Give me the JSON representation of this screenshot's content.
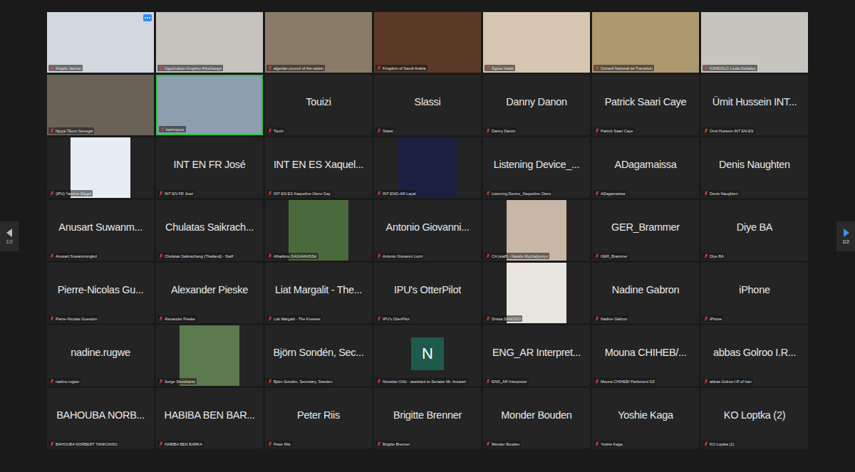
{
  "meeting": {
    "view": "gallery"
  },
  "pager": {
    "previous": {
      "label": "1/2",
      "enabled": false
    },
    "next": {
      "label": "1/2",
      "enabled": true
    }
  },
  "tiles": [
    {
      "kind": "video",
      "label": "Angelo Jacinto",
      "muted": true,
      "speaking": false,
      "color": "#d3d8e0",
      "menu": true
    },
    {
      "kind": "video",
      "label": "Ugochukwu Kingsley Ahuchaogu",
      "muted": true,
      "speaking": false,
      "color": "#c6c3bf",
      "menu": false
    },
    {
      "kind": "video",
      "label": "algerian council of the nation",
      "muted": true,
      "speaking": false,
      "color": "#8a7b68",
      "menu": false
    },
    {
      "kind": "video",
      "label": "Kingdom of Saudi Arabia",
      "muted": true,
      "speaking": false,
      "color": "#5a3a27",
      "menu": false
    },
    {
      "kind": "video",
      "label": "Ágnes Vadai",
      "muted": true,
      "speaking": false,
      "color": "#d6c6b2",
      "menu": false
    },
    {
      "kind": "video",
      "label": "Conseil National de Transition",
      "muted": true,
      "speaking": false,
      "color": "#ad9870",
      "menu": false
    },
    {
      "kind": "video",
      "label": "KANDOLO Linda Gwladys",
      "muted": true,
      "speaking": false,
      "color": "#c7c5bf",
      "menu": false
    },
    {
      "kind": "video",
      "label": "Njoya Tikum-Senegal",
      "muted": true,
      "speaking": false,
      "color": "#6a6157",
      "menu": false
    },
    {
      "kind": "video",
      "label": "karimipour",
      "muted": true,
      "speaking": true,
      "color": "#8d9fae",
      "menu": false
    },
    {
      "kind": "name",
      "display": "Touizi",
      "label": "Touizi",
      "muted": true,
      "speaking": false,
      "menu": false
    },
    {
      "kind": "name",
      "display": "Slassi",
      "label": "Slassi",
      "muted": true,
      "speaking": false,
      "menu": false
    },
    {
      "kind": "name",
      "display": "Danny Danon",
      "label": "Danny Danon",
      "muted": true,
      "speaking": false,
      "menu": false
    },
    {
      "kind": "name",
      "display": "Patrick Saari Caye",
      "label": "Patrick Saari Caye",
      "muted": true,
      "speaking": false,
      "menu": false
    },
    {
      "kind": "name",
      "display": "Ümit Hussein INT...",
      "label": "Ümit Hussein INT EN-ES",
      "muted": true,
      "speaking": false,
      "menu": false
    },
    {
      "kind": "avatar",
      "label": "(IPU) Yassine Elagdi",
      "muted": true,
      "speaking": false,
      "color": "#e6edf5",
      "menu": false
    },
    {
      "kind": "name",
      "display": "INT EN FR José",
      "label": "INT EN FR José",
      "muted": true,
      "speaking": false,
      "menu": false
    },
    {
      "kind": "name",
      "display": "INT EN ES Xaquel...",
      "label": "INT EN ES Xaqueline Otero Gay",
      "muted": true,
      "speaking": false,
      "menu": false
    },
    {
      "kind": "avatar",
      "label": "INT ENG-AR Layal",
      "muted": true,
      "speaking": false,
      "color": "#1c2142",
      "menu": false
    },
    {
      "kind": "name",
      "display": "Listening Device_...",
      "label": "Listening Device_Xaqueline Otero",
      "muted": true,
      "speaking": false,
      "menu": false
    },
    {
      "kind": "name",
      "display": "ADagamaissa",
      "label": "ADagamaissa",
      "muted": true,
      "speaking": false,
      "menu": false
    },
    {
      "kind": "name",
      "display": "Denis Naughten",
      "label": "Denis Naughten",
      "muted": true,
      "speaking": false,
      "menu": false
    },
    {
      "kind": "name",
      "display": "Anusart Suwanm...",
      "label": "Anusart Suwanmongkol",
      "muted": true,
      "speaking": false,
      "menu": false
    },
    {
      "kind": "name",
      "display": "Chulatas Saikrach...",
      "label": "Chulatas Saikrachang (Thailand) - Staff",
      "muted": true,
      "speaking": false,
      "menu": false
    },
    {
      "kind": "avatar",
      "label": "Alhatikou DAGAMAISSA",
      "muted": true,
      "speaking": false,
      "color": "#4b6a3c",
      "menu": false
    },
    {
      "kind": "name",
      "display": "Antonio Giovanni...",
      "label": "Antonio Giovanni Luzzi",
      "muted": true,
      "speaking": false,
      "menu": false
    },
    {
      "kind": "avatar",
      "label": "CA (staff) - Natalie Mychajlyszyn",
      "muted": true,
      "speaking": false,
      "color": "#c8b6a6",
      "menu": false
    },
    {
      "kind": "name",
      "display": "GER_Brammer",
      "label": "GER_Brammer",
      "muted": true,
      "speaking": false,
      "menu": false
    },
    {
      "kind": "name",
      "display": "Diye BA",
      "label": "Diye BA",
      "muted": true,
      "speaking": false,
      "menu": false
    },
    {
      "kind": "name",
      "display": "Pierre-Nicolas Gu...",
      "label": "Pierre-Nicolas Guesdon",
      "muted": true,
      "speaking": false,
      "menu": false
    },
    {
      "kind": "name",
      "display": "Alexander Pieske",
      "label": "Alexander Pieske",
      "muted": true,
      "speaking": false,
      "menu": false
    },
    {
      "kind": "name",
      "display": "Liat Margalit - The...",
      "label": "Liat Margalit - The Knesset",
      "muted": true,
      "speaking": false,
      "menu": false
    },
    {
      "kind": "name",
      "display": "IPU's OtterPilot",
      "label": "IPU's OtterPilot",
      "muted": true,
      "speaking": false,
      "menu": false
    },
    {
      "kind": "avatar",
      "label": "Drissa SANOGO",
      "muted": true,
      "speaking": false,
      "color": "#e9e5e0",
      "menu": false
    },
    {
      "kind": "name",
      "display": "Nadine Gabron",
      "label": "Nadine Gabron",
      "muted": true,
      "speaking": false,
      "menu": false
    },
    {
      "kind": "name",
      "display": "iPhone",
      "label": "iPhone",
      "muted": true,
      "speaking": false,
      "menu": false
    },
    {
      "kind": "name",
      "display": "nadine.rugwe",
      "label": "nadine.rugwe",
      "muted": true,
      "speaking": false,
      "menu": false
    },
    {
      "kind": "avatar",
      "label": "Serge Stroobants",
      "muted": true,
      "speaking": false,
      "color": "#5d7a4f",
      "menu": false
    },
    {
      "kind": "name",
      "display": "Björn Sondén, Sec...",
      "label": "Björn Sondén, Secretary, Sweden",
      "muted": true,
      "speaking": false,
      "menu": false
    },
    {
      "kind": "letter",
      "display": "N",
      "label": "Ninoslav Orlić - assistant to Senator Mr. Anusart",
      "muted": true,
      "speaking": false,
      "color": "#1e5a4b",
      "menu": false
    },
    {
      "kind": "name",
      "display": "ENG_AR Interpret...",
      "label": "ENG_AR Interpreter",
      "muted": true,
      "speaking": false,
      "menu": false
    },
    {
      "kind": "name",
      "display": "Mouna CHIHEB/...",
      "label": "Mouna CHIHEB/ Parlement DZ",
      "muted": true,
      "speaking": false,
      "menu": false
    },
    {
      "kind": "name",
      "display": "abbas Golroo I.R...",
      "label": "abbas Golroo I.R of Iran",
      "muted": true,
      "speaking": false,
      "menu": false
    },
    {
      "kind": "name",
      "display": "BAHOUBA NORB...",
      "label": "BAHOUBA NORBERT TANKOANO",
      "muted": true,
      "speaking": false,
      "menu": false
    },
    {
      "kind": "name",
      "display": "HABIBA BEN BAR...",
      "label": "HABIBA BEN BARKA",
      "muted": true,
      "speaking": false,
      "menu": false
    },
    {
      "kind": "name",
      "display": "Peter Riis",
      "label": "Peter Riis",
      "muted": true,
      "speaking": false,
      "menu": false
    },
    {
      "kind": "name",
      "display": "Brigitte Brenner",
      "label": "Brigitte Brenner",
      "muted": true,
      "speaking": false,
      "menu": false
    },
    {
      "kind": "name",
      "display": "Monder Bouden",
      "label": "Monder Bouden",
      "muted": true,
      "speaking": false,
      "menu": false
    },
    {
      "kind": "name",
      "display": "Yoshie Kaga",
      "label": "Yoshie Kaga",
      "muted": true,
      "speaking": false,
      "menu": false
    },
    {
      "kind": "name",
      "display": "KO Loptka (2)",
      "label": "KO Loptka (2)",
      "muted": true,
      "speaking": false,
      "menu": false
    }
  ]
}
